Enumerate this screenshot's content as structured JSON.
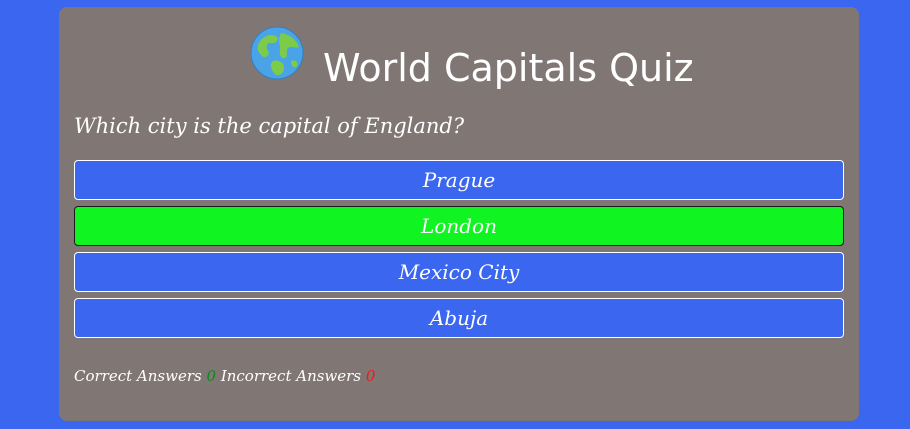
{
  "quiz": {
    "title": "World Capitals Quiz",
    "icon": "globe-icon",
    "question": "Which city is the capital of England?",
    "answers": [
      {
        "label": "Prague",
        "state": "default"
      },
      {
        "label": "London",
        "state": "correct"
      },
      {
        "label": "Mexico City",
        "state": "default"
      },
      {
        "label": "Abuja",
        "state": "default"
      }
    ],
    "score": {
      "correct_label": "Correct Answers",
      "correct_value": "0",
      "incorrect_label": "Incorrect Answers",
      "incorrect_value": "0"
    }
  },
  "colors": {
    "background": "#3a66f0",
    "card": "#807775",
    "answer_default": "#3a66f0",
    "answer_correct": "#10f521",
    "correct_count": "#0b8a1a",
    "incorrect_count": "#f01818"
  }
}
